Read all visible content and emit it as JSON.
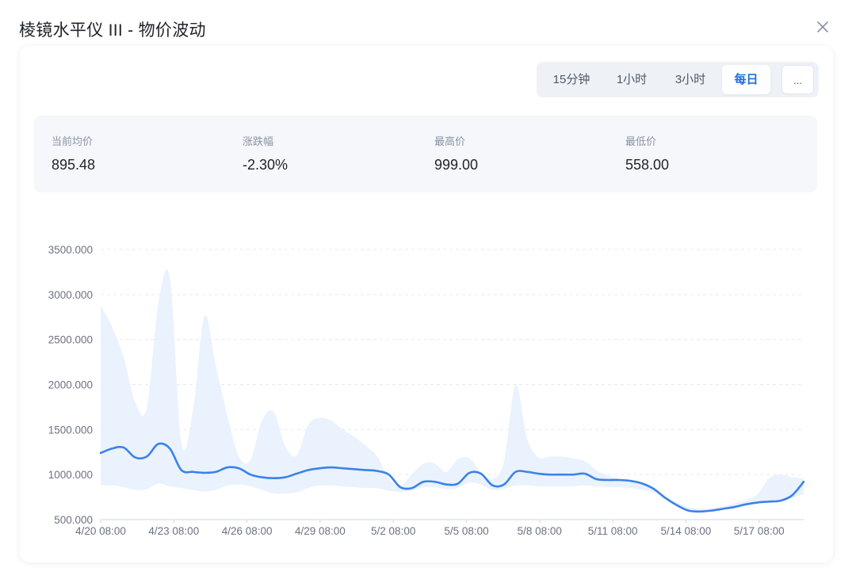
{
  "header": {
    "title": "棱镜水平仪 III - 物价波动"
  },
  "icons": {
    "close": "close-icon"
  },
  "range_tabs": [
    {
      "label": "15分钟",
      "active": false
    },
    {
      "label": "1小时",
      "active": false
    },
    {
      "label": "3小时",
      "active": false
    },
    {
      "label": "每日",
      "active": true
    }
  ],
  "more_label": "...",
  "stats": [
    {
      "label": "当前均价",
      "value": "895.48"
    },
    {
      "label": "涨跌幅",
      "value": "-2.30%"
    },
    {
      "label": "最高价",
      "value": "999.00"
    },
    {
      "label": "最低价",
      "value": "558.00"
    }
  ],
  "colors": {
    "accent": "#1e6fd9",
    "line": "#3b82e8",
    "band": "#e6f0fd",
    "grid": "#e5e9f0"
  },
  "chart_data": {
    "type": "line",
    "ylim": [
      500,
      3500
    ],
    "yticks": [
      "3500.000",
      "3000.000",
      "2500.000",
      "2000.000",
      "1500.000",
      "1000.000",
      "500.000"
    ],
    "xlabels": [
      "4/20 08:00",
      "4/23 08:00",
      "4/26 08:00",
      "4/29 08:00",
      "5/2 08:00",
      "5/5 08:00",
      "5/8 08:00",
      "5/11 08:00",
      "5/14 08:00",
      "5/17 08:00"
    ],
    "grid": true,
    "series": [
      {
        "values": [
          1240,
          1290,
          1300,
          1190,
          1200,
          1340,
          1290,
          1050,
          1030,
          1020,
          1030,
          1080,
          1070,
          1000,
          970,
          960,
          970,
          1010,
          1050,
          1070,
          1080,
          1070,
          1060,
          1050,
          1040,
          1000,
          860,
          850,
          920,
          920,
          890,
          900,
          1020,
          1010,
          880,
          890,
          1030,
          1030,
          1010,
          1000,
          1000,
          1000,
          1010,
          950,
          940,
          940,
          930,
          900,
          840,
          740,
          660,
          600,
          590,
          600,
          620,
          640,
          670,
          690,
          700,
          710,
          770,
          920
        ]
      },
      {
        "name": "range-upper",
        "values": [
          2880,
          2640,
          2300,
          1800,
          1740,
          2900,
          3180,
          1350,
          1700,
          2760,
          2200,
          1650,
          1200,
          1160,
          1600,
          1700,
          1320,
          1210,
          1550,
          1630,
          1600,
          1500,
          1420,
          1320,
          1200,
          960,
          880,
          1000,
          1120,
          1120,
          1030,
          1170,
          1180,
          1030,
          950,
          1150,
          2000,
          1400,
          1190,
          1200,
          1200,
          1180,
          1150,
          1050,
          990,
          950,
          940,
          910,
          850,
          760,
          690,
          640,
          620,
          630,
          650,
          680,
          720,
          780,
          960,
          1000,
          970,
          960
        ]
      },
      {
        "name": "range-lower",
        "values": [
          880,
          880,
          860,
          830,
          840,
          900,
          870,
          850,
          830,
          810,
          830,
          880,
          890,
          870,
          830,
          790,
          790,
          800,
          850,
          880,
          880,
          870,
          860,
          850,
          850,
          820,
          810,
          820,
          860,
          860,
          840,
          850,
          910,
          890,
          830,
          840,
          880,
          880,
          870,
          870,
          870,
          870,
          880,
          870,
          860,
          860,
          850,
          830,
          800,
          740,
          660,
          600,
          590,
          600,
          620,
          640,
          660,
          680,
          700,
          710,
          740,
          780
        ]
      }
    ]
  }
}
